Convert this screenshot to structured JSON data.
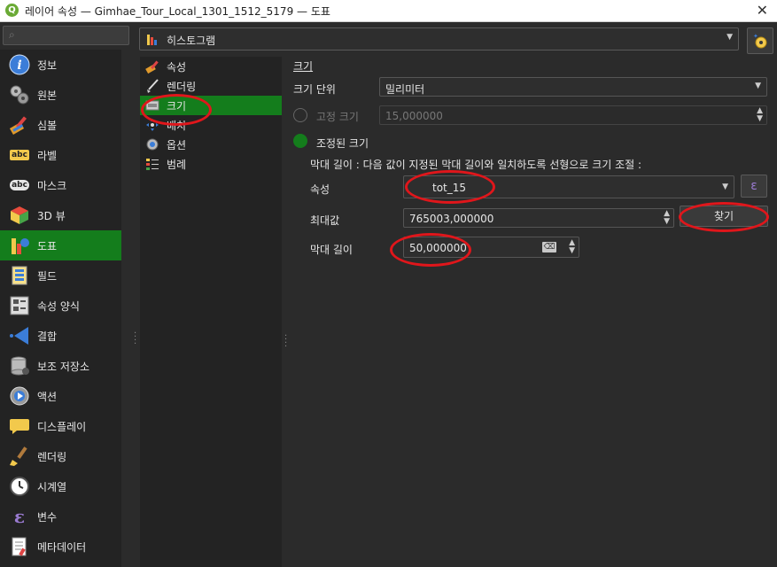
{
  "window": {
    "title": "레이어 속성 — Gimhae_Tour_Local_1301_1512_5179 — 도표",
    "close": "✕"
  },
  "sidebar": {
    "items": [
      {
        "label": "정보",
        "icon": "info-icon"
      },
      {
        "label": "원본",
        "icon": "source-icon"
      },
      {
        "label": "심볼",
        "icon": "symbology-icon"
      },
      {
        "label": "라벨",
        "icon": "labels-icon"
      },
      {
        "label": "마스크",
        "icon": "mask-icon"
      },
      {
        "label": "3D 뷰",
        "icon": "3d-view-icon"
      },
      {
        "label": "도표",
        "icon": "diagram-icon",
        "active": true
      },
      {
        "label": "필드",
        "icon": "fields-icon"
      },
      {
        "label": "속성 양식",
        "icon": "attributes-form-icon"
      },
      {
        "label": "결합",
        "icon": "joins-icon"
      },
      {
        "label": "보조 저장소",
        "icon": "auxiliary-storage-icon"
      },
      {
        "label": "액션",
        "icon": "actions-icon"
      },
      {
        "label": "디스플레이",
        "icon": "display-icon"
      },
      {
        "label": "렌더링",
        "icon": "rendering-icon"
      },
      {
        "label": "시계열",
        "icon": "temporal-icon"
      },
      {
        "label": "변수",
        "icon": "variables-icon"
      },
      {
        "label": "메타데이터",
        "icon": "metadata-icon"
      }
    ]
  },
  "renderer": {
    "selected": "히스토그램",
    "icon_abc": "abc"
  },
  "tree": {
    "items": [
      {
        "label": "속성"
      },
      {
        "label": "렌더링"
      },
      {
        "label": "크기",
        "active": true
      },
      {
        "label": "배치"
      },
      {
        "label": "옵션"
      },
      {
        "label": "범례"
      }
    ]
  },
  "size": {
    "section_title": "크기",
    "unit_label": "크기 단위",
    "unit_value": "밀리미터",
    "fixed_label": "고정 크기",
    "fixed_value": "15,000000",
    "scaled_label": "조정된 크기",
    "description": "막대 길이 : 다음 값이 지정된 막대 길이와 일치하도록 선형으로 크기 조절 :",
    "attribute_label": "속성",
    "attribute_value": "tot_15",
    "max_label": "최대값",
    "max_value": "765003,000000",
    "find_button": "찾기",
    "bar_length_label": "막대 길이",
    "bar_length_value": "50,000000",
    "expression_symbol": "ε",
    "clear_symbol": "⌫"
  },
  "colors": {
    "accent_green": "#147d1c",
    "annotation_red": "#e0161b"
  }
}
